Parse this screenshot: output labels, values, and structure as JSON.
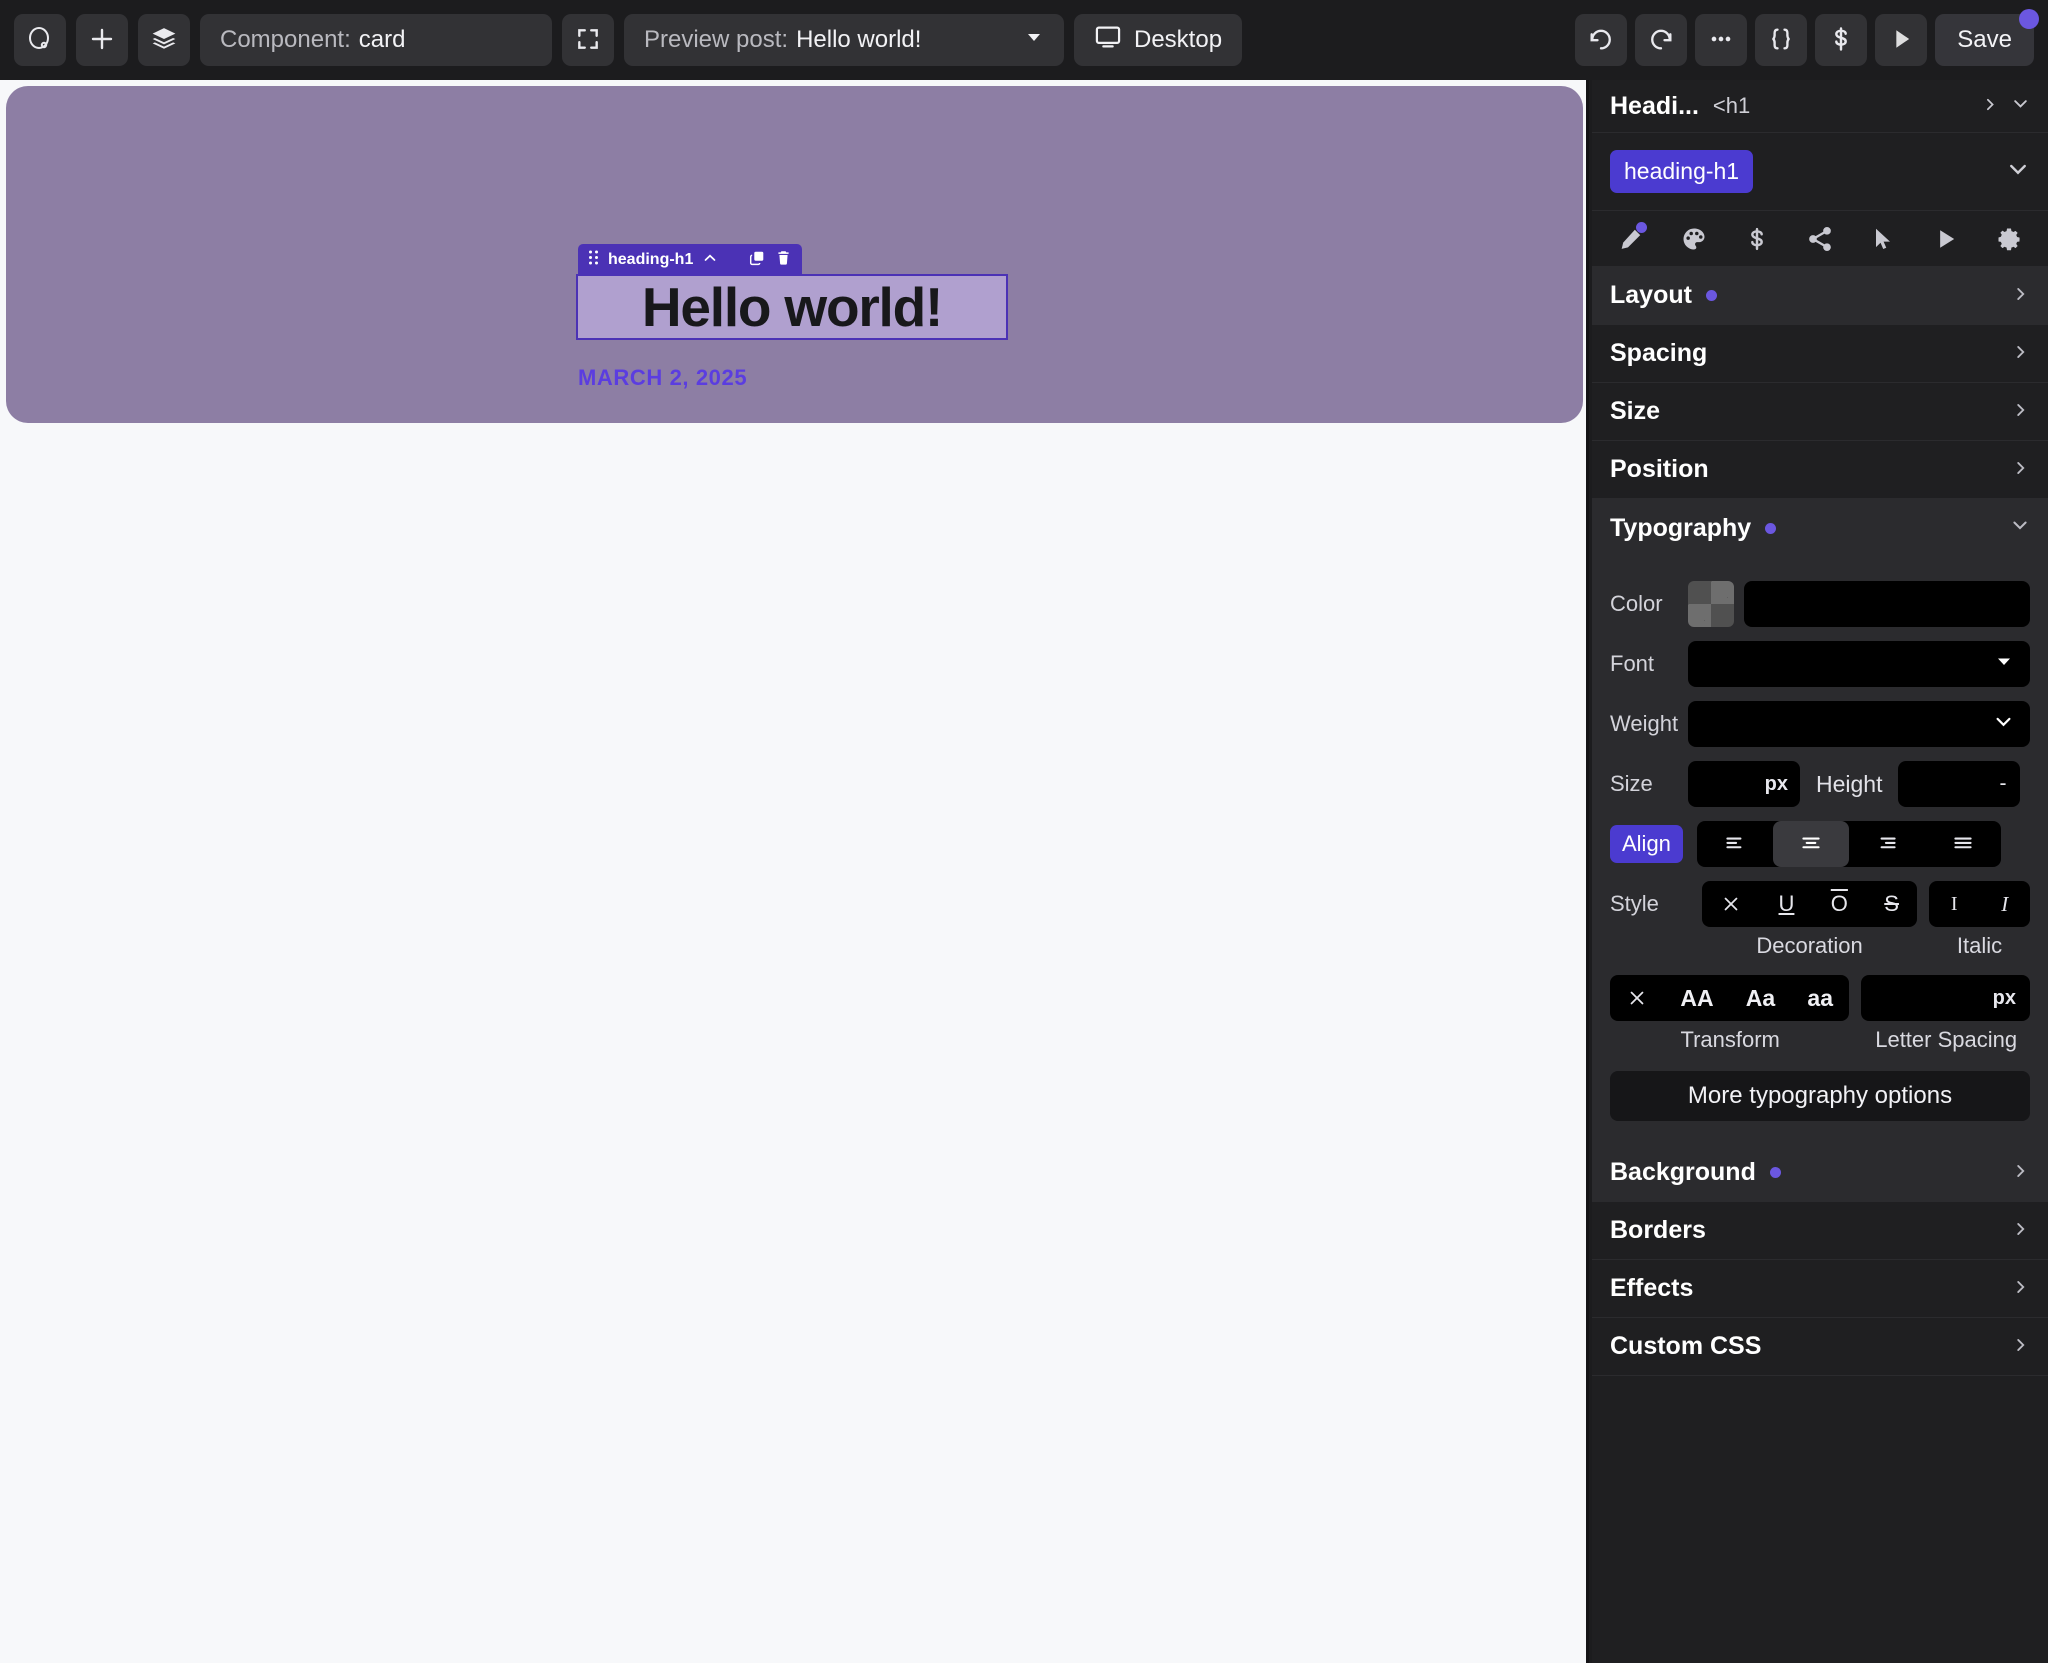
{
  "topbar": {
    "logo_icon": "app-logo-icon",
    "add_label": "+",
    "layers_icon": "layers-icon",
    "component_label": "Component:",
    "component_value": "card",
    "fullscreen_icon": "fullscreen-icon",
    "preview_label": "Preview post:",
    "preview_value": "Hello world!",
    "viewport_label": "Desktop",
    "viewport_icon": "monitor-icon",
    "undo_icon": "undo-icon",
    "redo_icon": "redo-icon",
    "more_icon": "ellipsis-icon",
    "code_icon": "code-braces-icon",
    "dollar_icon": "dollar-icon",
    "play_icon": "play-icon",
    "save_label": "Save",
    "save_has_badge": true
  },
  "canvas": {
    "card_background": "#8d7ea4",
    "page_background": "#f7f8fa",
    "heading_text": "Hello world!",
    "date_text": "MARCH 2, 2025",
    "date_color": "#5b3de0",
    "selection_color": "#4b32b5",
    "selection_label": "heading-h1",
    "drag_icon": "drag-handle-icon",
    "collapse_icon": "chevron-up-icon",
    "duplicate_icon": "duplicate-icon",
    "delete_icon": "trash-icon"
  },
  "panel": {
    "title": "Headi...",
    "tag": "<h1",
    "next_icon": "chevron-right-icon",
    "expand_icon": "chevron-down-icon",
    "chip_label": "heading-h1",
    "chip_chevron_icon": "chevron-down-icon",
    "tabs": [
      {
        "name": "style-tab",
        "icon": "pencil-icon",
        "badge": true
      },
      {
        "name": "theme-tab",
        "icon": "palette-icon",
        "badge": false
      },
      {
        "name": "variables-tab",
        "icon": "dollar-icon",
        "badge": false
      },
      {
        "name": "connections-tab",
        "icon": "share-nodes-icon",
        "badge": false
      },
      {
        "name": "interactions-tab",
        "icon": "cursor-icon",
        "badge": false
      },
      {
        "name": "animation-tab",
        "icon": "play-icon",
        "badge": false
      },
      {
        "name": "settings-tab",
        "icon": "gear-icon",
        "badge": false
      }
    ],
    "sections": [
      {
        "label": "Layout",
        "dot": true,
        "highlighted": true,
        "open": false
      },
      {
        "label": "Spacing",
        "dot": false,
        "highlighted": false,
        "open": false
      },
      {
        "label": "Size",
        "dot": false,
        "highlighted": false,
        "open": false
      },
      {
        "label": "Position",
        "dot": false,
        "highlighted": false,
        "open": false
      }
    ],
    "typography": {
      "label": "Typography",
      "dot": true,
      "color_label": "Color",
      "color_value": "",
      "color_swatch": "transparent-checker",
      "font_label": "Font",
      "font_value": "",
      "weight_label": "Weight",
      "weight_value": "",
      "size_label": "Size",
      "size_value": "",
      "size_unit": "px",
      "height_label": "Height",
      "height_value": "",
      "height_unit": "-",
      "align_label": "Align",
      "align_options": [
        "align-left",
        "align-center",
        "align-right",
        "align-justify"
      ],
      "align_selected_index": 1,
      "style_label": "Style",
      "decoration_caption": "Decoration",
      "decoration_options": [
        "none",
        "underline",
        "overline",
        "line-through"
      ],
      "italic_caption": "Italic",
      "italic_options": [
        "upright",
        "italic"
      ],
      "transform_caption": "Transform",
      "transform_options": [
        "none",
        "AA",
        "Aa",
        "aa"
      ],
      "letter_spacing_caption": "Letter Spacing",
      "letter_spacing_value": "",
      "letter_spacing_unit": "px",
      "more_label": "More typography options"
    },
    "sections_bottom": [
      {
        "label": "Background",
        "dot": true,
        "highlighted": true
      },
      {
        "label": "Borders",
        "dot": false,
        "highlighted": false
      },
      {
        "label": "Effects",
        "dot": false,
        "highlighted": false
      },
      {
        "label": "Custom CSS",
        "dot": false,
        "highlighted": false
      }
    ]
  }
}
